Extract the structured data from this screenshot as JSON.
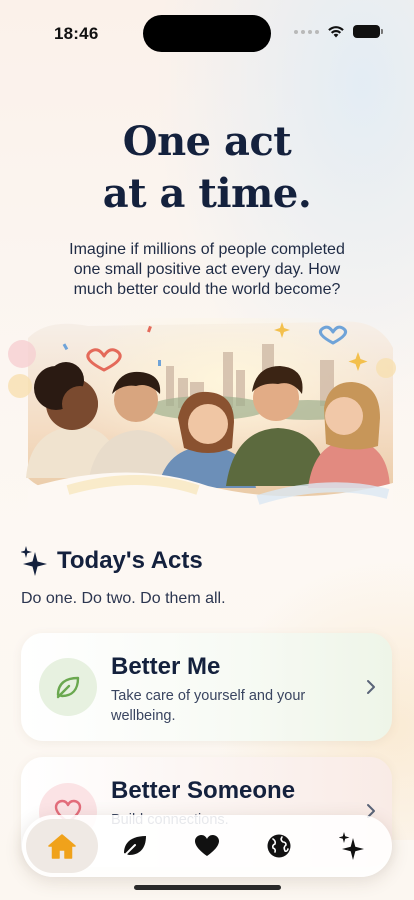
{
  "status_bar": {
    "time": "18:46"
  },
  "hero": {
    "title_line1": "One act",
    "title_line2": "at a time.",
    "text": "Imagine if millions of people completed one small positive act every day. How much better could the world become?"
  },
  "section": {
    "title": "Today's Acts",
    "subtitle": "Do one. Do two. Do them all."
  },
  "cards": [
    {
      "title": "Better Me",
      "description": "Take care of yourself and your wellbeing.",
      "icon": "leaf-icon",
      "accent": "#6aa84f"
    },
    {
      "title": "Better Someone",
      "description": "Build connections.",
      "icon": "heart-icon",
      "accent": "#e36d7b"
    }
  ],
  "tab_bar": {
    "items": [
      {
        "icon": "home-icon",
        "active": true
      },
      {
        "icon": "leaf-icon",
        "active": false
      },
      {
        "icon": "heart-icon",
        "active": false
      },
      {
        "icon": "globe-icon",
        "active": false
      },
      {
        "icon": "sparkles-icon",
        "active": false
      }
    ]
  },
  "colors": {
    "navy": "#14213d",
    "home_accent": "#f0a21b",
    "background": "#fbf5f0"
  }
}
